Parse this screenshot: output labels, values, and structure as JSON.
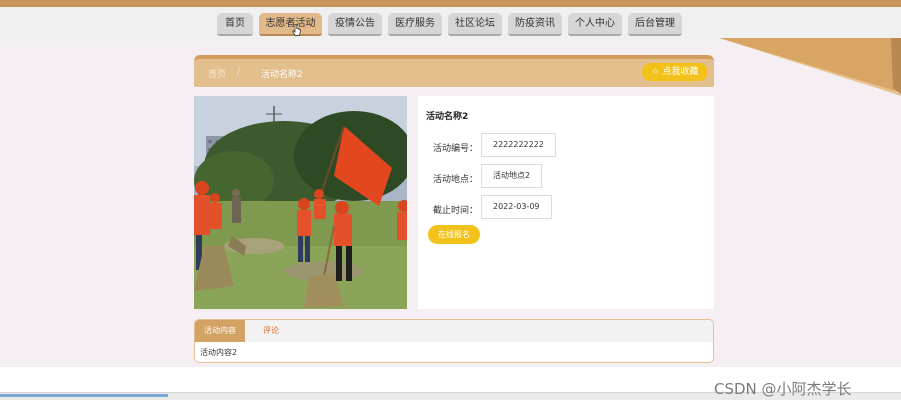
{
  "nav": {
    "items": [
      {
        "label": "首页"
      },
      {
        "label": "志愿者活动"
      },
      {
        "label": "疫情公告"
      },
      {
        "label": "医疗服务"
      },
      {
        "label": "社区论坛"
      },
      {
        "label": "防疫资讯"
      },
      {
        "label": "个人中心"
      },
      {
        "label": "后台管理"
      }
    ],
    "active_index": 1
  },
  "breadcrumb": {
    "home": "首页",
    "separator": "/",
    "current": "活动名称2"
  },
  "favorite_button": {
    "label": "☆ 点我收藏"
  },
  "activity": {
    "title": "活动名称2",
    "fields": [
      {
        "label": "活动编号：",
        "value": "2222222222"
      },
      {
        "label": "活动地点：",
        "value": "活动地点2"
      },
      {
        "label": "截止时间：",
        "value": "2022-03-09"
      }
    ],
    "signup_label": "在线报名"
  },
  "tabs": {
    "items": [
      {
        "label": "活动内容"
      },
      {
        "label": "评论"
      }
    ],
    "active_index": 0,
    "content": "活动内容2"
  },
  "watermark": "CSDN @小阿杰学长",
  "colors": {
    "accent": "#e2bf8d",
    "accent_dark": "#d39d5e",
    "button_yellow": "#f2c21a",
    "nav_active": "#e2b988",
    "background": "#f5eff4"
  }
}
